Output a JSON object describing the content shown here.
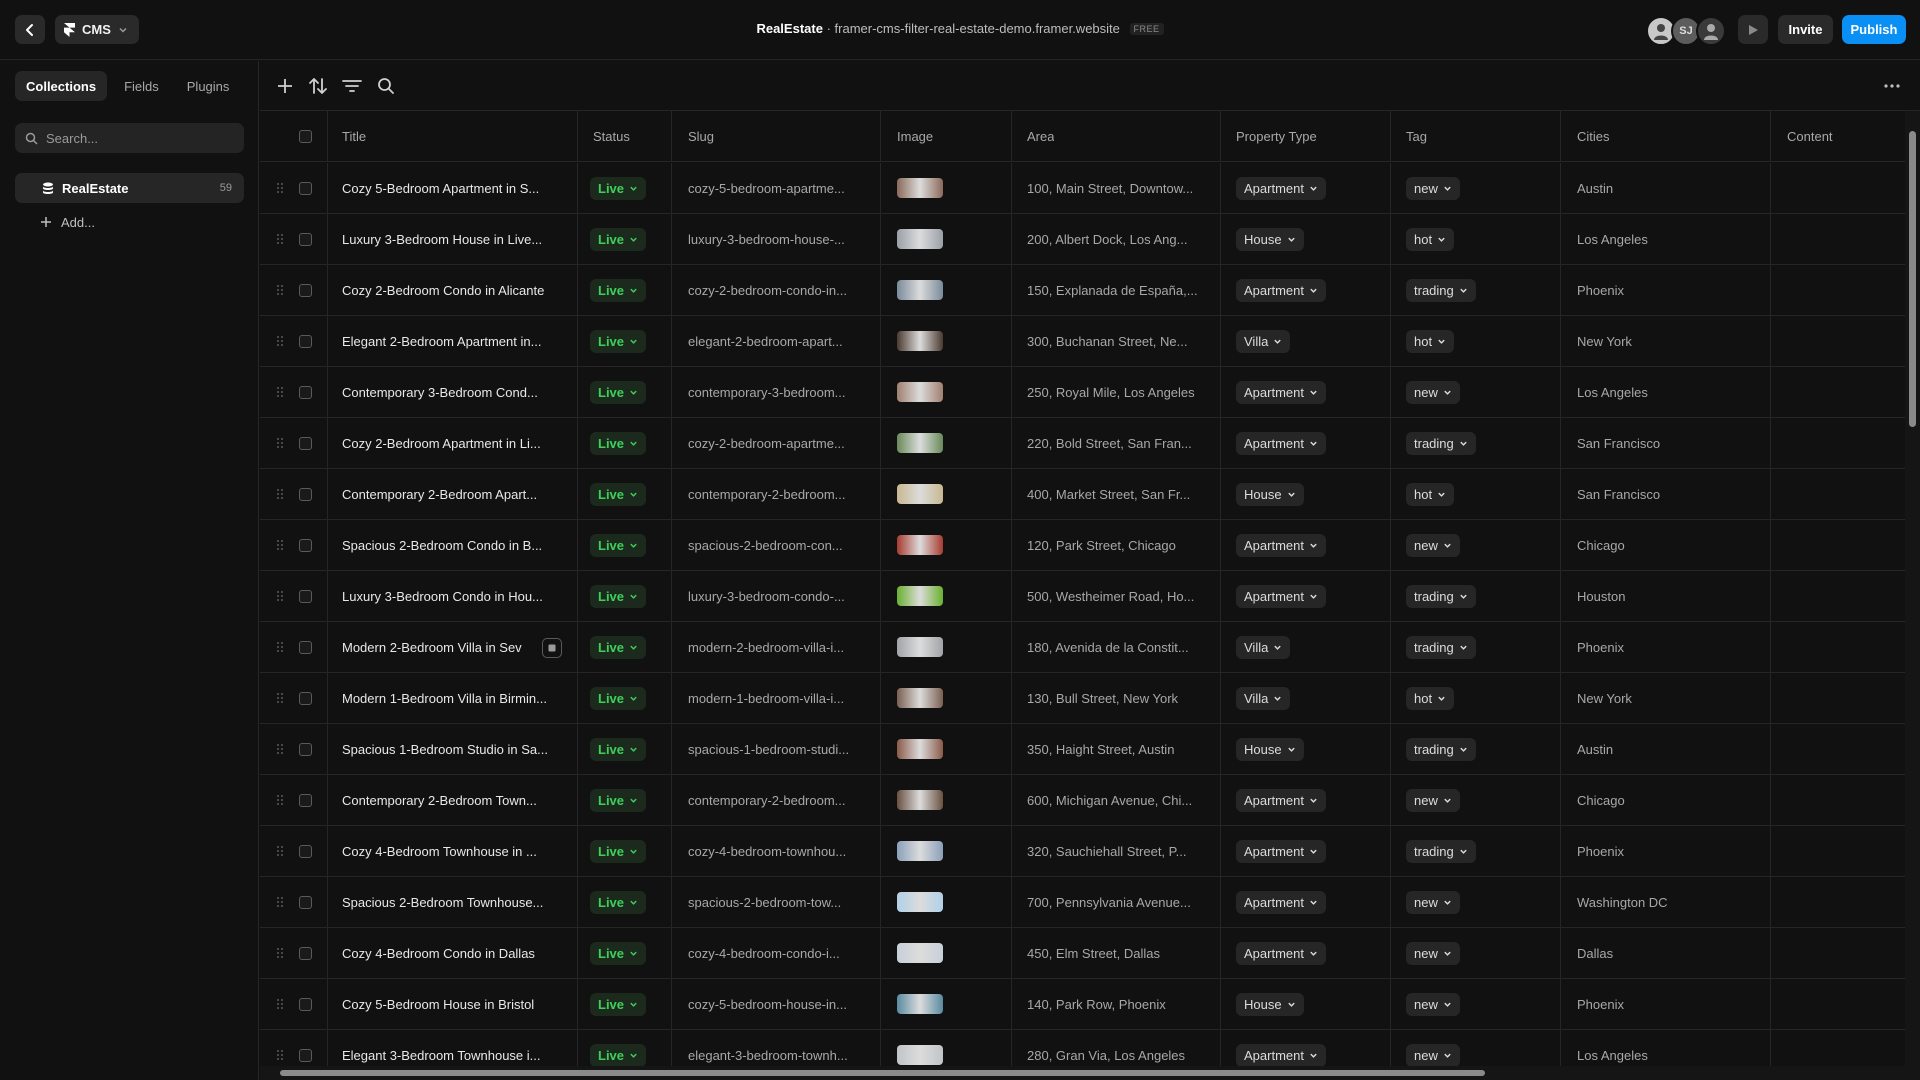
{
  "topbar": {
    "cms_label": "CMS",
    "project_name": "RealEstate",
    "separator": "·",
    "domain": "framer-cms-filter-real-estate-demo.framer.website",
    "plan_badge": "FREE",
    "avatar_initials": "SJ",
    "invite_label": "Invite",
    "publish_label": "Publish"
  },
  "sidebar": {
    "tabs": [
      "Collections",
      "Fields",
      "Plugins"
    ],
    "search_placeholder": "Search...",
    "collection": {
      "name": "RealEstate",
      "count": "59"
    },
    "add_label": "Add..."
  },
  "table": {
    "columns": [
      "Title",
      "Status",
      "Slug",
      "Image",
      "Area",
      "Property Type",
      "Tag",
      "Cities",
      "Content"
    ],
    "rows": [
      {
        "title": "Cozy 5-Bedroom Apartment in S...",
        "status": "Live",
        "slug": "cozy-5-bedroom-apartme...",
        "area": "100, Main Street, Downtow...",
        "ptype": "Apartment",
        "tag": "new",
        "city": "Austin"
      },
      {
        "title": "Luxury 3-Bedroom House in Live...",
        "status": "Live",
        "slug": "luxury-3-bedroom-house-...",
        "area": "200, Albert Dock, Los Ang...",
        "ptype": "House",
        "tag": "hot",
        "city": "Los Angeles"
      },
      {
        "title": "Cozy 2-Bedroom Condo in Alicante",
        "status": "Live",
        "slug": "cozy-2-bedroom-condo-in...",
        "area": "150, Explanada de España,...",
        "ptype": "Apartment",
        "tag": "trading",
        "city": "Phoenix"
      },
      {
        "title": "Elegant 2-Bedroom Apartment in...",
        "status": "Live",
        "slug": "elegant-2-bedroom-apart...",
        "area": "300, Buchanan Street, Ne...",
        "ptype": "Villa",
        "tag": "hot",
        "city": "New York"
      },
      {
        "title": "Contemporary 3-Bedroom Cond...",
        "status": "Live",
        "slug": "contemporary-3-bedroom...",
        "area": "250, Royal Mile, Los Angeles",
        "ptype": "Apartment",
        "tag": "new",
        "city": "Los Angeles"
      },
      {
        "title": "Cozy 2-Bedroom Apartment in Li...",
        "status": "Live",
        "slug": "cozy-2-bedroom-apartme...",
        "area": "220, Bold Street, San Fran...",
        "ptype": "Apartment",
        "tag": "trading",
        "city": "San Francisco"
      },
      {
        "title": "Contemporary 2-Bedroom Apart...",
        "status": "Live",
        "slug": "contemporary-2-bedroom...",
        "area": "400, Market Street, San Fr...",
        "ptype": "House",
        "tag": "hot",
        "city": "San Francisco"
      },
      {
        "title": "Spacious 2-Bedroom Condo in B...",
        "status": "Live",
        "slug": "spacious-2-bedroom-con...",
        "area": "120, Park Street, Chicago",
        "ptype": "Apartment",
        "tag": "new",
        "city": "Chicago"
      },
      {
        "title": "Luxury 3-Bedroom Condo in Hou...",
        "status": "Live",
        "slug": "luxury-3-bedroom-condo-...",
        "area": "500, Westheimer Road, Ho...",
        "ptype": "Apartment",
        "tag": "trading",
        "city": "Houston"
      },
      {
        "title": "Modern 2-Bedroom Villa in Sev",
        "status": "Live",
        "slug": "modern-2-bedroom-villa-i...",
        "area": "180, Avenida de la Constit...",
        "ptype": "Villa",
        "tag": "trading",
        "city": "Phoenix"
      },
      {
        "title": "Modern 1-Bedroom Villa in Birmin...",
        "status": "Live",
        "slug": "modern-1-bedroom-villa-i...",
        "area": "130, Bull Street, New York",
        "ptype": "Villa",
        "tag": "hot",
        "city": "New York"
      },
      {
        "title": "Spacious 1-Bedroom Studio in Sa...",
        "status": "Live",
        "slug": "spacious-1-bedroom-studi...",
        "area": "350, Haight Street, Austin",
        "ptype": "House",
        "tag": "trading",
        "city": "Austin"
      },
      {
        "title": "Contemporary 2-Bedroom Town...",
        "status": "Live",
        "slug": "contemporary-2-bedroom...",
        "area": "600, Michigan Avenue, Chi...",
        "ptype": "Apartment",
        "tag": "new",
        "city": "Chicago"
      },
      {
        "title": "Cozy 4-Bedroom Townhouse in ...",
        "status": "Live",
        "slug": "cozy-4-bedroom-townhou...",
        "area": "320, Sauchiehall Street, P...",
        "ptype": "Apartment",
        "tag": "trading",
        "city": "Phoenix"
      },
      {
        "title": "Spacious 2-Bedroom Townhouse...",
        "status": "Live",
        "slug": "spacious-2-bedroom-tow...",
        "area": "700, Pennsylvania Avenue...",
        "ptype": "Apartment",
        "tag": "new",
        "city": "Washington DC"
      },
      {
        "title": "Cozy 4-Bedroom Condo in Dallas",
        "status": "Live",
        "slug": "cozy-4-bedroom-condo-i...",
        "area": "450, Elm Street, Dallas",
        "ptype": "Apartment",
        "tag": "new",
        "city": "Dallas"
      },
      {
        "title": "Cozy 5-Bedroom House in Bristol",
        "status": "Live",
        "slug": "cozy-5-bedroom-house-in...",
        "area": "140, Park Row, Phoenix",
        "ptype": "House",
        "tag": "new",
        "city": "Phoenix"
      },
      {
        "title": "Elegant 3-Bedroom Townhouse i...",
        "status": "Live",
        "slug": "elegant-3-bedroom-townh...",
        "area": "280, Gran Via, Los Angeles",
        "ptype": "Apartment",
        "tag": "new",
        "city": "Los Angeles"
      }
    ]
  },
  "colors": {
    "background": "#111111",
    "accent": "#0a8ff5",
    "live_text": "#3ecf5a",
    "live_bg": "#1c2a1d",
    "thumbnails": [
      "#8a6a5a",
      "#9aa0a8",
      "#7a8a9a",
      "#4a3a30",
      "#a08070",
      "#6a8a5a",
      "#c8b890",
      "#a83a30",
      "#6ab030",
      "#a0a4a8",
      "#7a6050",
      "#8a5a4a",
      "#6a5040",
      "#8aa0b8",
      "#b0d0e8",
      "#c8d0d8",
      "#5a8aa0",
      "#c0c4c8"
    ]
  },
  "icons": {
    "back": "chevron-left-icon",
    "cms": "framer-logo-icon",
    "play": "play-icon",
    "add": "plus-icon",
    "sort": "sort-icon",
    "filter": "filter-icon",
    "search": "search-icon",
    "more": "more-horizontal-icon"
  }
}
